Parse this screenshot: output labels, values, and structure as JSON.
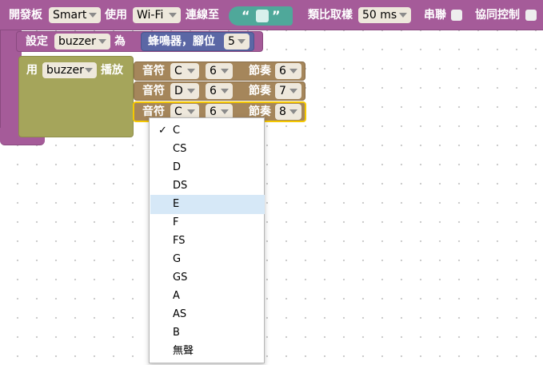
{
  "board": {
    "label_board": "開發板",
    "board_value": "Smart",
    "label_use": "使用",
    "conn_value": "Wi-Fi",
    "label_connect": "連線至",
    "quote_open": "“",
    "quote_close": "”",
    "label_sampling": "類比取樣",
    "sampling_value": "50 ms",
    "label_serial": "串聯",
    "label_coop": "協同控制"
  },
  "setvar": {
    "label_set": "設定",
    "var_name": "buzzer",
    "label_as": "為",
    "value_label": "蜂鳴器，腳位",
    "pin_value": "5"
  },
  "play": {
    "label_use": "用",
    "var_name": "buzzer",
    "label_play": "播放"
  },
  "notes": [
    {
      "label_note": "音符",
      "note": "C",
      "octave": "6",
      "label_beat": "節奏",
      "beat": "6"
    },
    {
      "label_note": "音符",
      "note": "D",
      "octave": "6",
      "label_beat": "節奏",
      "beat": "7"
    },
    {
      "label_note": "音符",
      "note": "C",
      "octave": "6",
      "label_beat": "節奏",
      "beat": "8"
    }
  ],
  "dropdown": {
    "selected": "C",
    "highlighted": "E",
    "check_glyph": "✓",
    "items": [
      "C",
      "CS",
      "D",
      "DS",
      "E",
      "F",
      "FS",
      "G",
      "GS",
      "A",
      "AS",
      "B",
      "無聲"
    ]
  },
  "colors": {
    "board_block": "#a55b99",
    "value_block": "#5b67a5",
    "play_block": "#a5a55b",
    "note_block": "#a5865b",
    "text_block": "#4fa89a",
    "selection_outline": "#f5c800",
    "dropdown_highlight": "#d6e8f7"
  }
}
